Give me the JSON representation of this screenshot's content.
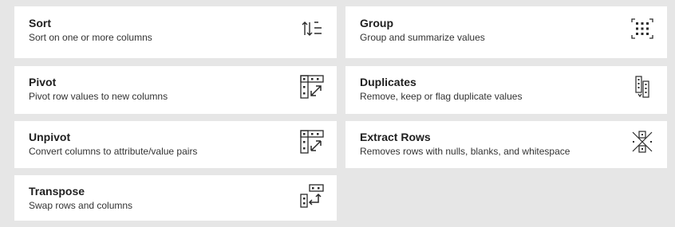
{
  "cards": [
    {
      "title": "Sort",
      "description": "Sort on one or more columns",
      "icon": "sort-icon"
    },
    {
      "title": "Group",
      "description": "Group and summarize values",
      "icon": "group-icon"
    },
    {
      "title": "Pivot",
      "description": "Pivot row values to new columns",
      "icon": "pivot-icon"
    },
    {
      "title": "Duplicates",
      "description": "Remove, keep or flag duplicate values",
      "icon": "duplicates-icon"
    },
    {
      "title": "Unpivot",
      "description": "Convert columns to attribute/value pairs",
      "icon": "unpivot-icon"
    },
    {
      "title": "Extract Rows",
      "description": "Removes rows with nulls, blanks, and whitespace",
      "icon": "extract-rows-icon"
    },
    {
      "title": "Transpose",
      "description": "Swap rows and columns",
      "icon": "transpose-icon"
    }
  ],
  "colors": {
    "background": "#e6e6e6",
    "card": "#ffffff",
    "icon": "#2a2a2a",
    "accent": "#1a73b8"
  }
}
